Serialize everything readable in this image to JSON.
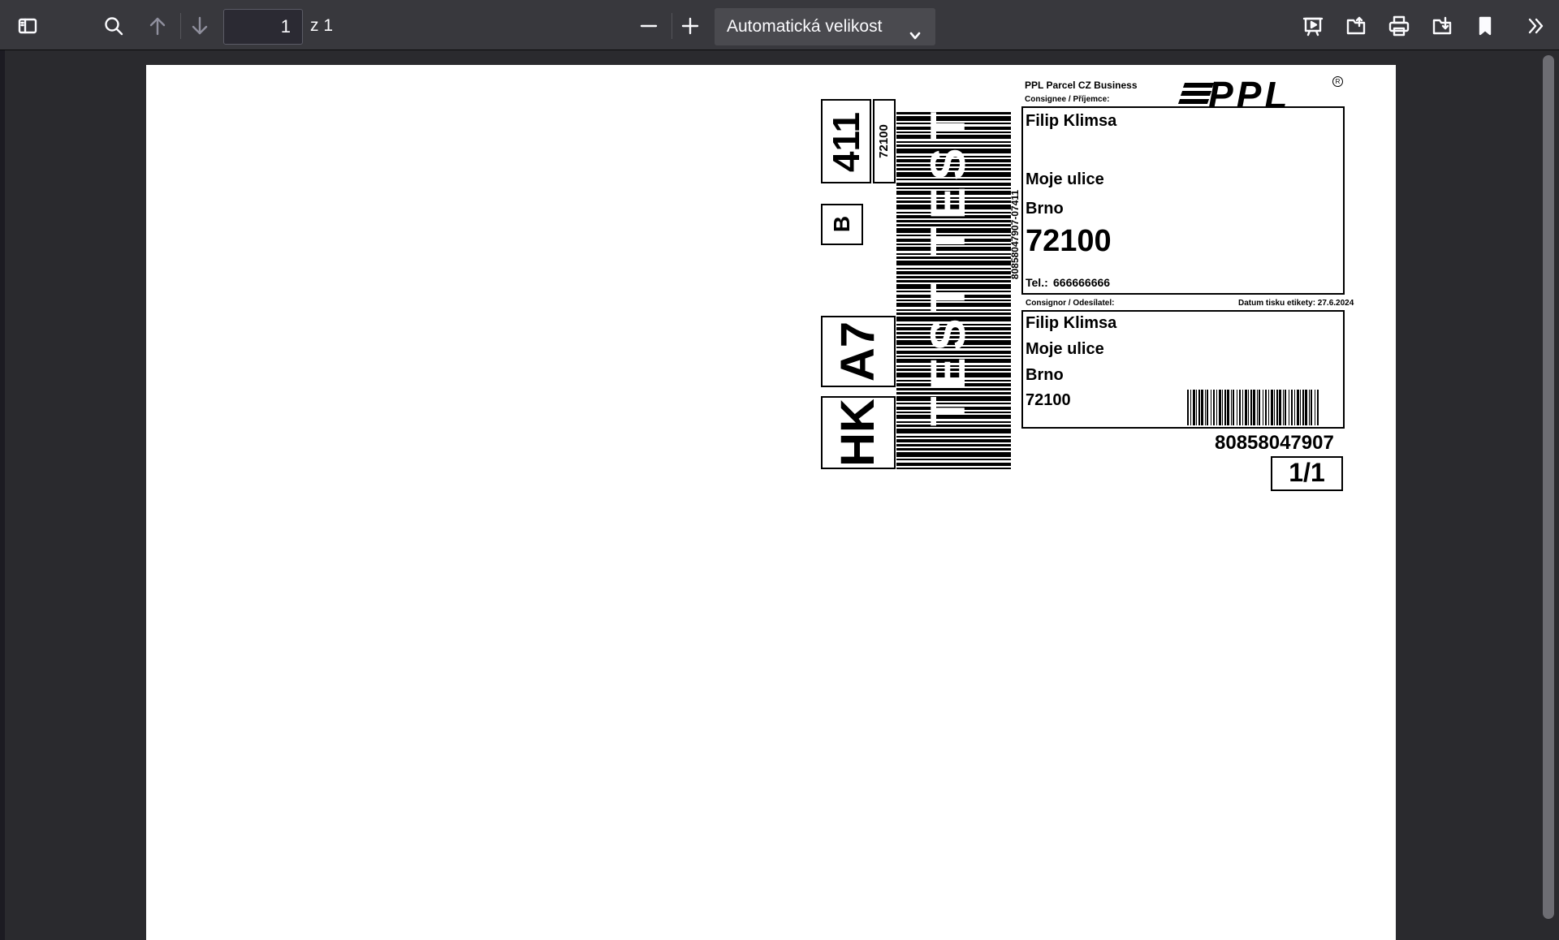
{
  "toolbar": {
    "page_value": "1",
    "page_total": "z 1",
    "zoom_label": "Automatická velikost",
    "icons": [
      "sidebar-toggle-icon",
      "search-icon",
      "arrow-up-icon",
      "arrow-down-icon",
      "minus-icon",
      "plus-icon",
      "chevron-down-icon",
      "presentation-icon",
      "open-file-icon",
      "print-icon",
      "download-icon",
      "bookmark-icon",
      "double-chevron-right-icon"
    ]
  },
  "label": {
    "carrier_line": "PPL Parcel CZ Business",
    "logo_text": "PPL",
    "consignee_header": "Consignee / Příjemce:",
    "consignee": {
      "name": "Filip Klimsa",
      "street": "Moje ulice",
      "city": "Brno",
      "zip": "72100",
      "phone_label": "Tel.:",
      "phone": "666666666"
    },
    "consignor_header": "Consignor / Odesílatel:",
    "print_date": "Datum tisku etikety: 27.6.2024",
    "consignor": {
      "name": "Filip Klimsa",
      "street": "Moje ulice",
      "city": "Brno",
      "zip": "72100"
    },
    "parcel_number": "80858047907",
    "package_count": "1/1",
    "route_code": "411",
    "route_zip": "72100",
    "route_letter": "B",
    "depot_code": "A7",
    "region_code": "HK",
    "barcode_text": "80858047907-07411",
    "test_watermark": "TEST TEST"
  }
}
